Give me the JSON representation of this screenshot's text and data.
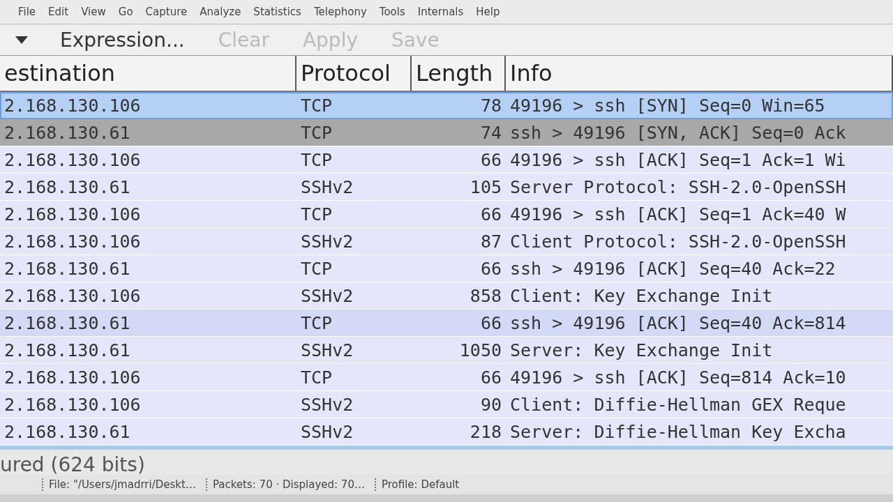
{
  "menu": [
    "File",
    "Edit",
    "View",
    "Go",
    "Capture",
    "Analyze",
    "Statistics",
    "Telephony",
    "Tools",
    "Internals",
    "Help"
  ],
  "filter_toolbar": {
    "buttons": [
      "Expression...",
      "Clear",
      "Apply",
      "Save"
    ]
  },
  "columns": [
    "estination",
    "Protocol",
    "Length",
    "Info"
  ],
  "rows": [
    {
      "destination": "2.168.130.106",
      "protocol": "TCP",
      "length": "78",
      "info": "49196 > ssh [SYN] Seq=0 Win=65",
      "color": "#b4d0f4",
      "selected": true
    },
    {
      "destination": "2.168.130.61",
      "protocol": "TCP",
      "length": "74",
      "info": "ssh > 49196 [SYN, ACK] Seq=0 Ack",
      "color": "#a8a8a8",
      "selected": false
    },
    {
      "destination": "2.168.130.106",
      "protocol": "TCP",
      "length": "66",
      "info": "49196 > ssh [ACK] Seq=1 Ack=1 Wi",
      "color": "#e6e6fa",
      "selected": false
    },
    {
      "destination": "2.168.130.61",
      "protocol": "SSHv2",
      "length": "105",
      "info": "Server Protocol: SSH-2.0-OpenSSH",
      "color": "#e6e6fa",
      "selected": false
    },
    {
      "destination": "2.168.130.106",
      "protocol": "TCP",
      "length": "66",
      "info": "49196 > ssh [ACK] Seq=1 Ack=40 W",
      "color": "#e6e6fa",
      "selected": false
    },
    {
      "destination": "2.168.130.106",
      "protocol": "SSHv2",
      "length": "87",
      "info": "Client Protocol: SSH-2.0-OpenSSH",
      "color": "#e6e6fa",
      "selected": false
    },
    {
      "destination": "2.168.130.61",
      "protocol": "TCP",
      "length": "66",
      "info": "ssh > 49196 [ACK] Seq=40 Ack=22",
      "color": "#e6e6fa",
      "selected": false
    },
    {
      "destination": "2.168.130.106",
      "protocol": "SSHv2",
      "length": "858",
      "info": "Client: Key Exchange Init",
      "color": "#e6e6fa",
      "selected": false
    },
    {
      "destination": "2.168.130.61",
      "protocol": "TCP",
      "length": "66",
      "info": "ssh > 49196 [ACK] Seq=40 Ack=814",
      "color": "#d2daf6",
      "selected": false
    },
    {
      "destination": "2.168.130.61",
      "protocol": "SSHv2",
      "length": "1050",
      "info": "Server: Key Exchange Init",
      "color": "#e6e6fa",
      "selected": false
    },
    {
      "destination": "2.168.130.106",
      "protocol": "TCP",
      "length": "66",
      "info": "49196 > ssh [ACK] Seq=814 Ack=10",
      "color": "#e6e6fa",
      "selected": false
    },
    {
      "destination": "2.168.130.106",
      "protocol": "SSHv2",
      "length": "90",
      "info": "Client: Diffie-Hellman GEX Reque",
      "color": "#e6e6fa",
      "selected": false
    },
    {
      "destination": "2.168.130.61",
      "protocol": "SSHv2",
      "length": "218",
      "info": "Server: Diffie-Hellman Key Excha",
      "color": "#e6e6fa",
      "selected": false
    }
  ],
  "detail_caption": "ured (624 bits)",
  "status_bar": [
    "File: \"/Users/jmadrri/Deskt…",
    "Packets: 70 · Displayed: 70…",
    "Profile: Default"
  ]
}
